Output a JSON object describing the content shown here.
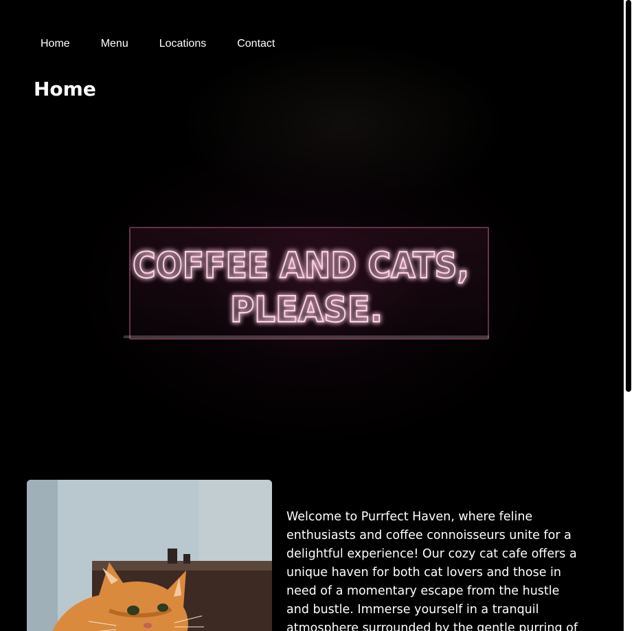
{
  "nav": {
    "items": [
      {
        "label": "Home"
      },
      {
        "label": "Menu"
      },
      {
        "label": "Locations"
      },
      {
        "label": "Contact"
      }
    ]
  },
  "page": {
    "title": "Home"
  },
  "hero": {
    "sign_line1": "COFFEE AND CATS,",
    "sign_line2": "PLEASE.",
    "neon_color": "#ff5fa2"
  },
  "intro": {
    "text": "Welcome to Purrfect Haven, where feline enthusiasts and coffee connoisseurs unite for a delightful experience! Our cozy cat cafe offers a unique haven for both cat lovers and those in need of a momentary escape from the hustle and bustle. Immerse yourself in a tranquil atmosphere surrounded by the gentle purring of"
  },
  "theme": {
    "background": "#000000",
    "text": "#ffffff"
  }
}
